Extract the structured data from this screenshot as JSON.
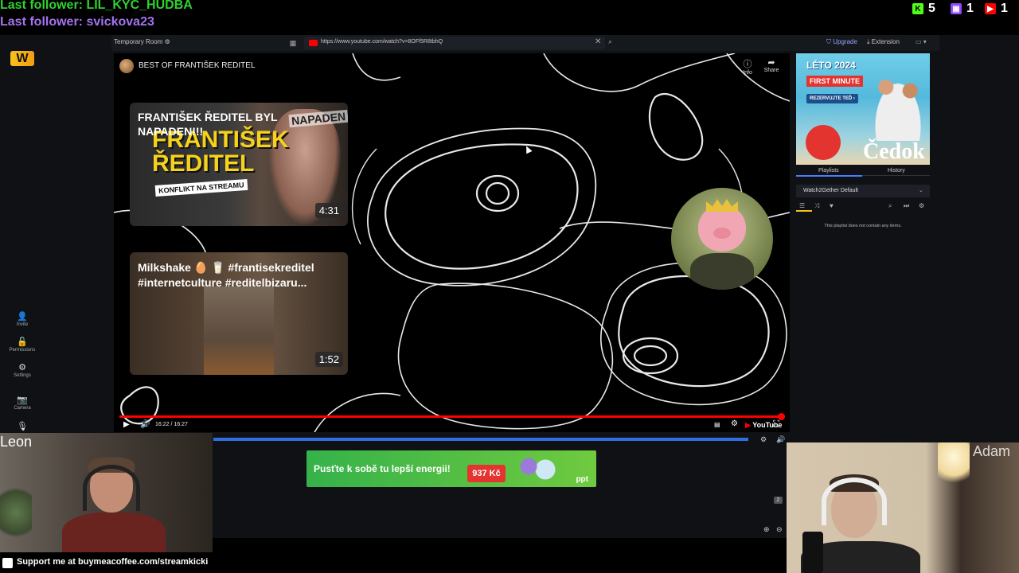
{
  "overlay": {
    "last_follower_1": "Last follower: LIL_KYC_HUDBA",
    "last_follower_2": "Last follower: svickova23",
    "counters": [
      {
        "platform": "kick",
        "icon": "kick-icon",
        "value": "5",
        "color": "#53fc18"
      },
      {
        "platform": "twitch",
        "icon": "twitch-icon",
        "value": "1",
        "color": "#9146ff"
      },
      {
        "platform": "youtube",
        "icon": "youtube-icon",
        "value": "1",
        "color": "#ff0000"
      }
    ],
    "support_text": "Support me at buymeacoffee.com/streamkicki"
  },
  "app": {
    "room_title": "Temporary Room ⚙",
    "url": "https://www.youtube.com/watch?v=8OFf5R8tbhQ",
    "upgrade_label": "Upgrade",
    "extension_label": "Extension",
    "logo_text": "W"
  },
  "sidebar": {
    "items": [
      {
        "label": "Invite",
        "glyph": "👤"
      },
      {
        "label": "Permissions",
        "glyph": "🔓"
      },
      {
        "label": "Settings",
        "glyph": "⚙"
      },
      {
        "label": "Camera",
        "glyph": "📷"
      }
    ]
  },
  "video": {
    "channel_title": "BEST OF FRANTIŠEK REDITEL",
    "info_label": "Info",
    "share_label": "Share",
    "time": "16:22 / 16:27",
    "progress": 0.995,
    "youtube_label": "YouTube",
    "thumbnails": [
      {
        "title": "FRANTIŠEK ŘEDITEL BYL NAPADEN!!!",
        "big_text": "FRANTIŠEK ŘEDITEL",
        "sub_text": "KONFLIKT NA STREAMU",
        "corner_text": "NAPADEN",
        "duration": "4:31"
      },
      {
        "title": "Milkshake 🥚 🥛 #frantisekreditel #internetculture #reditelbizaru...",
        "duration": "1:52"
      }
    ]
  },
  "ads": {
    "bottom": {
      "text": "Pusťte k sobě tu lepší energii!",
      "price": "937 Kč",
      "brand": "ppt"
    },
    "right": {
      "top": "LÉTO 2024",
      "red": "FIRST MINUTE",
      "button": "REZERVUJTE TEĎ ›",
      "brand": "Čedok"
    }
  },
  "playlist": {
    "tab_playlists": "Playlists",
    "tab_history": "History",
    "selected": "Watch2Gether Default",
    "empty_text": "This playlist does not contain any items."
  },
  "webcams": {
    "left_name": "Leon",
    "right_name": "Adam"
  },
  "chat": {
    "badge": "2"
  }
}
